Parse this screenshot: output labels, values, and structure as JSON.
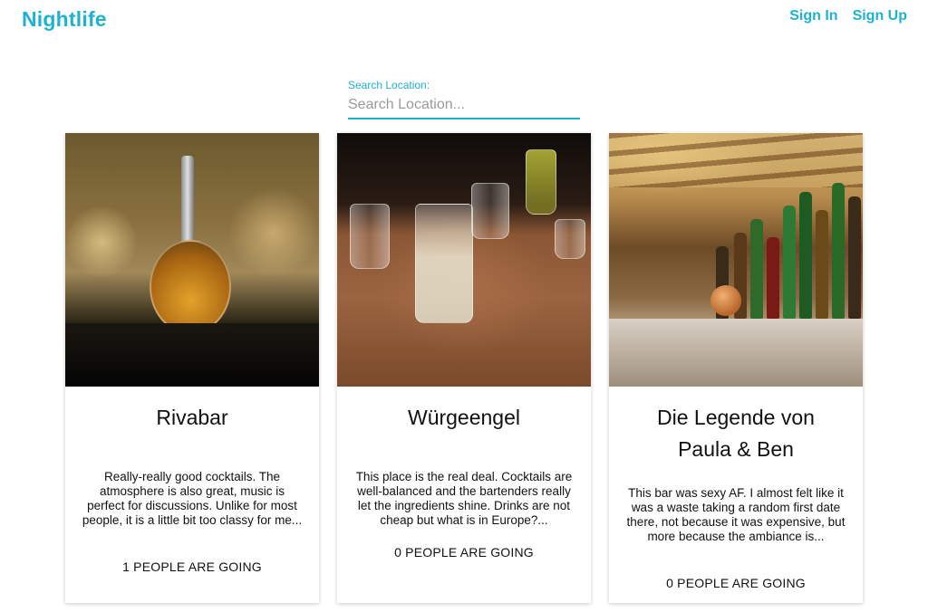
{
  "header": {
    "logo": "Nightlife",
    "nav": {
      "sign_in": "Sign In",
      "sign_up": "Sign Up"
    }
  },
  "search": {
    "label": "Search Location:",
    "placeholder": "Search Location...",
    "value": ""
  },
  "bars": [
    {
      "name": "Rivabar",
      "description": "Really-really good cocktails. The atmosphere is also great, music is perfect for discussions. Unlike for most people, it is a little bit too classy for me...",
      "going": "1 PEOPLE ARE GOING",
      "photo": "cocktail-decanter-photo"
    },
    {
      "name": "Würgeengel",
      "description": "This place is the real deal. Cocktails are well-balanced and the bartenders really let the ingredients shine. Drinks are not cheap but what is in Europe?...",
      "going": "0 PEOPLE ARE GOING",
      "photo": "glasses-on-table-photo"
    },
    {
      "name": "Die Legende von Paula & Ben",
      "description": "This bar was sexy AF. I almost felt like it was a waste taking a random first date there, not because it was expensive, but more because the ambiance is...",
      "going": "0 PEOPLE ARE GOING",
      "photo": "bar-shelf-photo"
    }
  ],
  "colors": {
    "accent": "#1fb2cf"
  }
}
